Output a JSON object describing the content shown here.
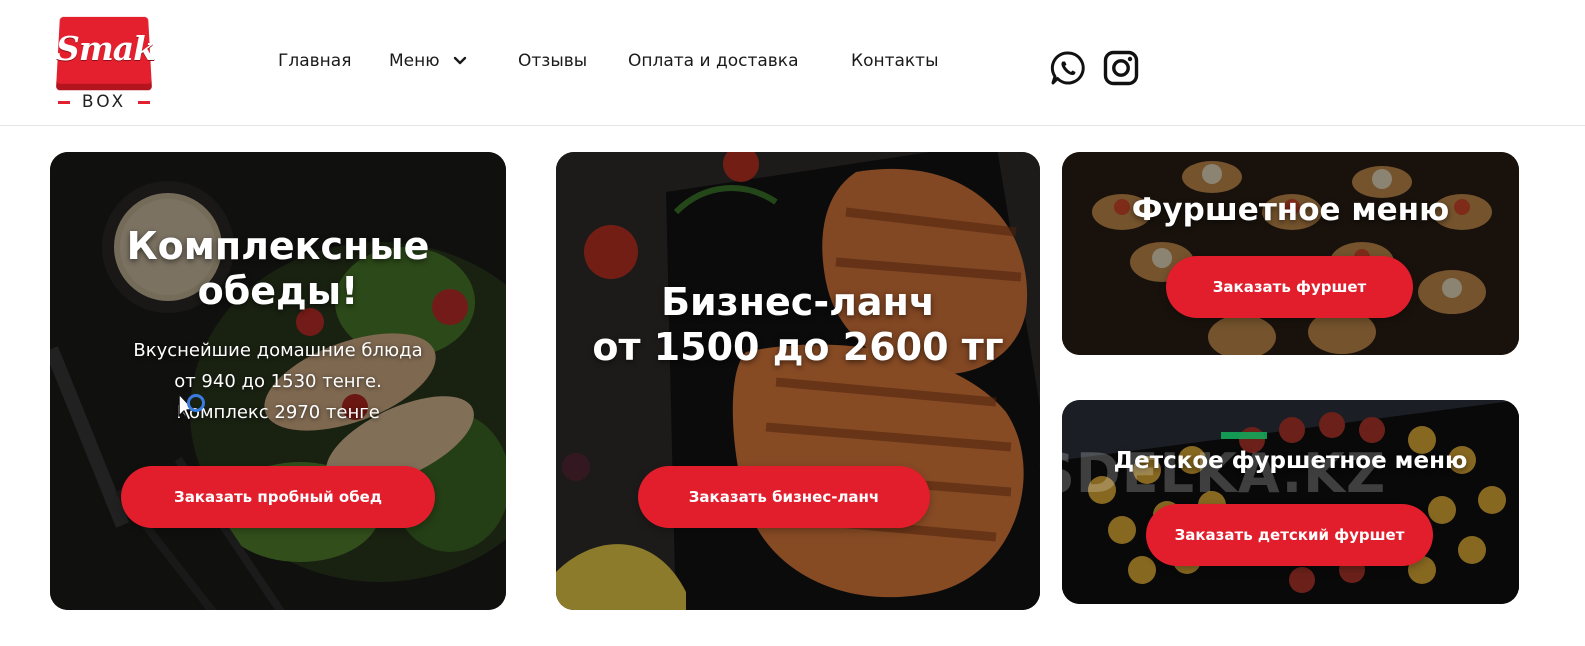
{
  "logo": {
    "main": "Smak",
    "sub": "BOX"
  },
  "nav": {
    "items": [
      {
        "label": "Главная"
      },
      {
        "label": "Меню"
      },
      {
        "label": "Отзывы"
      },
      {
        "label": "Оплата и доставка"
      },
      {
        "label": "Контакты"
      }
    ],
    "social_icons": [
      "whatsapp-icon",
      "instagram-icon"
    ]
  },
  "cards": {
    "complex": {
      "title": "Комплексные обеды!",
      "desc_lines": [
        "Вкуснейшие домашние блюда",
        "от 940 до 1530 тенге.",
        "Комплекс 2970 тенге"
      ],
      "button": "Заказать пробный обед"
    },
    "business": {
      "title_line1": "Бизнес-ланч",
      "title_line2": "от 1500 до 2600 тг",
      "button": "Заказать бизнес-ланч"
    },
    "buffet": {
      "title": "Фуршетное меню",
      "button": "Заказать фуршет"
    },
    "kids": {
      "title": "Детское фуршетное меню",
      "button": "Заказать детский фуршет"
    }
  },
  "watermark": "SDELKA.KZ",
  "colors": {
    "accent": "#e21d2c",
    "text": "#1a1a1a",
    "white": "#ffffff"
  }
}
